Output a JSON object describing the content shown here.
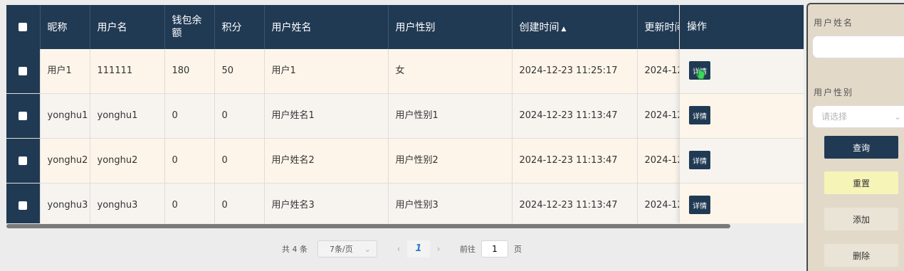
{
  "table": {
    "headers": {
      "nickname": "昵称",
      "username": "用户名",
      "balance": "钱包余额",
      "points": "积分",
      "real_name": "用户姓名",
      "gender": "用户性别",
      "created": "创建时间",
      "updated": "更新时间",
      "ops": "操作"
    },
    "rows": [
      {
        "nickname": "用户1",
        "username": "111111",
        "balance": "180",
        "points": "50",
        "real_name": "用户1",
        "gender": "女",
        "created": "2024-12-23 11:25:17",
        "updated": "2024-12",
        "detail": "详情"
      },
      {
        "nickname": "yonghu1",
        "username": "yonghu1",
        "balance": "0",
        "points": "0",
        "real_name": "用户姓名1",
        "gender": "用户性别1",
        "created": "2024-12-23 11:13:47",
        "updated": "2024-12",
        "detail": "详情"
      },
      {
        "nickname": "yonghu2",
        "username": "yonghu2",
        "balance": "0",
        "points": "0",
        "real_name": "用户姓名2",
        "gender": "用户性别2",
        "created": "2024-12-23 11:13:47",
        "updated": "2024-12",
        "detail": "详情"
      },
      {
        "nickname": "yonghu3",
        "username": "yonghu3",
        "balance": "0",
        "points": "0",
        "real_name": "用户姓名3",
        "gender": "用户性别3",
        "created": "2024-12-23 11:13:47",
        "updated": "2024-12",
        "detail": "详情"
      }
    ]
  },
  "pagination": {
    "total": "共 4 条",
    "page_size": "7条/页",
    "current_page": "1",
    "goto_prefix": "前往",
    "goto_value": "1",
    "goto_suffix": "页"
  },
  "sidebar": {
    "name_label": "用户姓名",
    "gender_label": "用户性别",
    "gender_placeholder": "请选择",
    "query": "查询",
    "reset": "重置",
    "add": "添加",
    "delete": "删除"
  },
  "colors": {
    "header_bg": "#213a54",
    "row_bg": "#fdf5ea",
    "accent": "#2d7cc6",
    "reset_bg": "#f7f4b8"
  }
}
